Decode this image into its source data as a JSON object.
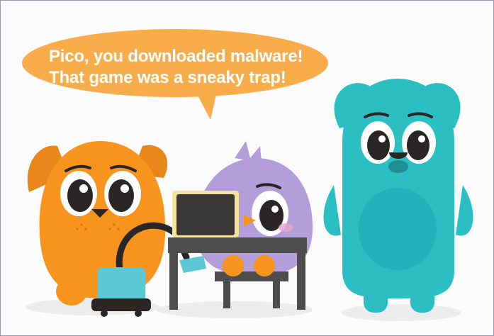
{
  "speech": {
    "line1": "Pico, you downloaded malware!",
    "line2": "That game was a sneaky trap!"
  },
  "colors": {
    "bubble": "#f9ad4a",
    "orange_character": "#f7941d",
    "purple_character": "#b39ddb",
    "teal_character": "#2bbfc4",
    "vacuum": "#5bc8d6",
    "desk": "#4d4d4d",
    "laptop": "#3b3838"
  },
  "icons": {
    "orange-character": "puppy-character",
    "purple-character": "bird-character",
    "teal-character": "teal-puppy-character",
    "vacuum": "vacuum-cleaner",
    "laptop": "laptop"
  }
}
